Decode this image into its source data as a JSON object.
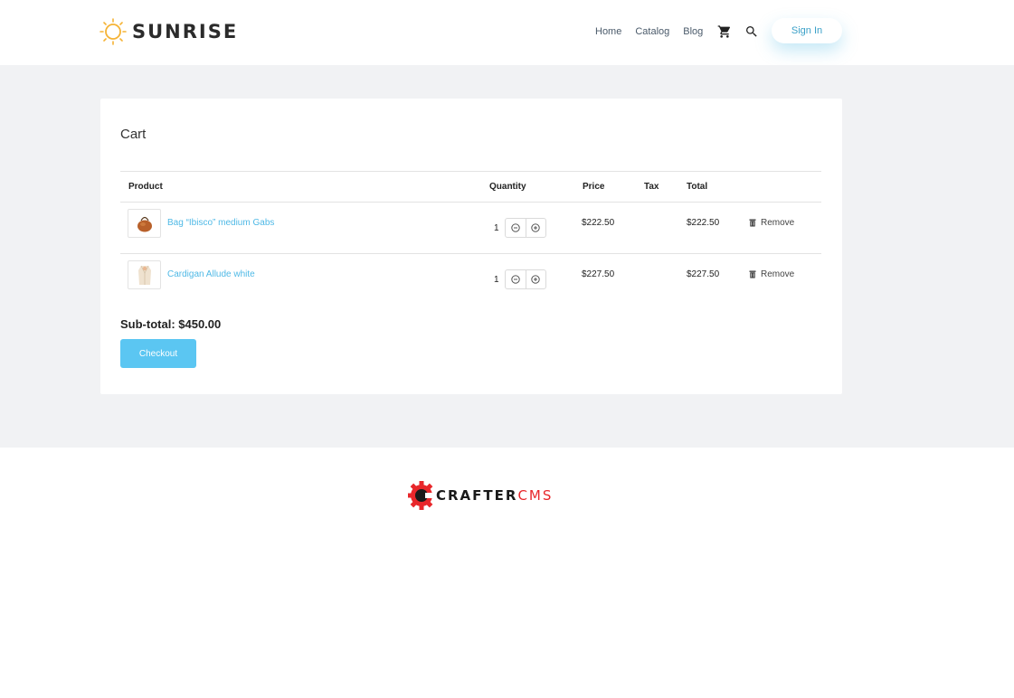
{
  "header": {
    "brand": "SUNRISE",
    "brand_icon": "sun-icon",
    "nav": [
      {
        "label": "Home"
      },
      {
        "label": "Catalog"
      },
      {
        "label": "Blog"
      }
    ],
    "cart_icon": "shopping-cart-icon",
    "search_icon": "search-icon",
    "sign_in_label": "Sign In"
  },
  "cart": {
    "title": "Cart",
    "columns": {
      "product": "Product",
      "quantity": "Quantity",
      "price": "Price",
      "tax": "Tax",
      "total": "Total"
    },
    "items": [
      {
        "name": "Bag “Ibisco” medium Gabs",
        "quantity": "1",
        "price": "$222.50",
        "tax": "",
        "total": "$222.50",
        "remove_label": "Remove"
      },
      {
        "name": "Cardigan Allude white",
        "quantity": "1",
        "price": "$227.50",
        "tax": "",
        "total": "$227.50",
        "remove_label": "Remove"
      }
    ],
    "subtotal": "Sub-total: $450.00",
    "checkout_label": "Checkout"
  },
  "footer": {
    "logo_text_1": "CRAFTER",
    "logo_text_2": "CMS"
  },
  "colors": {
    "accent": "#5bc6f2",
    "link": "#4fb9e6",
    "page_bg": "#f1f2f4",
    "crafter_red": "#e8272b"
  }
}
